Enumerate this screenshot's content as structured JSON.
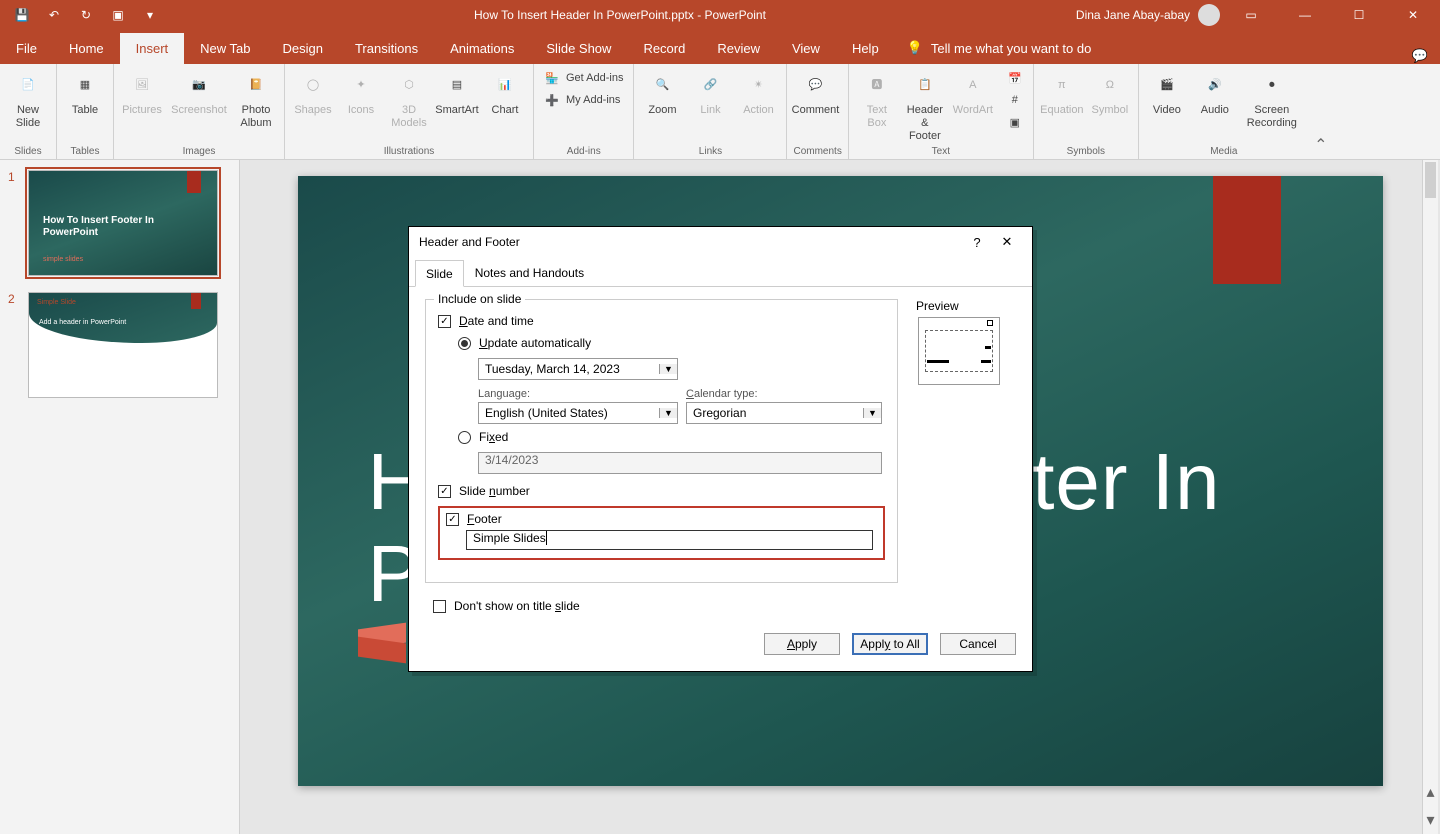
{
  "titlebar": {
    "doc_title": "How To Insert Header In PowerPoint.pptx  -  PowerPoint",
    "user_name": "Dina Jane Abay-abay"
  },
  "menubar": {
    "tabs": [
      "File",
      "Home",
      "Insert",
      "New Tab",
      "Design",
      "Transitions",
      "Animations",
      "Slide Show",
      "Record",
      "Review",
      "View",
      "Help"
    ],
    "active_index": 2,
    "tell_me": "Tell me what you want to do"
  },
  "ribbon": {
    "groups": {
      "slides": {
        "label": "Slides",
        "new_slide": "New\nSlide"
      },
      "tables": {
        "label": "Tables",
        "table": "Table"
      },
      "images": {
        "label": "Images",
        "pictures": "Pictures",
        "screenshot": "Screenshot",
        "photo_album": "Photo\nAlbum"
      },
      "illustrations": {
        "label": "Illustrations",
        "shapes": "Shapes",
        "icons": "Icons",
        "models": "3D\nModels",
        "smartart": "SmartArt",
        "chart": "Chart"
      },
      "addins": {
        "label": "Add-ins",
        "get": "Get Add-ins",
        "my": "My Add-ins"
      },
      "links": {
        "label": "Links",
        "zoom": "Zoom",
        "link": "Link",
        "action": "Action"
      },
      "comments": {
        "label": "Comments",
        "comment": "Comment"
      },
      "text": {
        "label": "Text",
        "text_box": "Text\nBox",
        "header_footer": "Header\n& Footer",
        "wordart": "WordArt"
      },
      "symbols": {
        "label": "Symbols",
        "equation": "Equation",
        "symbol": "Symbol"
      },
      "media": {
        "label": "Media",
        "video": "Video",
        "audio": "Audio",
        "screen_rec": "Screen\nRecording"
      }
    }
  },
  "thumbs": {
    "t1": {
      "num": "1",
      "title": "How To Insert Footer In PowerPoint",
      "logo": "simple slides"
    },
    "t2": {
      "num": "2",
      "title": "Simple Slide",
      "text": "Add a header in PowerPoint"
    }
  },
  "slide": {
    "title_line1": "How To Insert Footer In",
    "title_line2": "PowerPoint",
    "logo_text": "simple slides"
  },
  "dialog": {
    "title": "Header and Footer",
    "tabs": {
      "slide": "Slide",
      "notes": "Notes and Handouts"
    },
    "include_legend": "Include on slide",
    "date_time": "Date and time",
    "update_auto": "Update automatically",
    "date_value": "Tuesday, March 14, 2023",
    "language_label": "Language:",
    "language_value": "English (United States)",
    "calendar_label": "Calendar type:",
    "calendar_value": "Gregorian",
    "fixed": "Fixed",
    "fixed_value": "3/14/2023",
    "slide_number": "Slide number",
    "footer": "Footer",
    "footer_value": "Simple Slides",
    "dont_show": "Don't show on title slide",
    "preview": "Preview",
    "btn_apply": "Apply",
    "btn_apply_all": "Apply to All",
    "btn_cancel": "Cancel"
  }
}
